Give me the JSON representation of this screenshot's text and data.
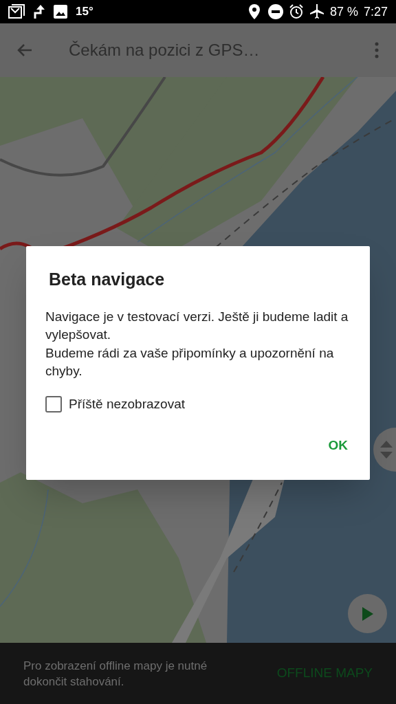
{
  "status_bar": {
    "temperature": "15°",
    "battery": "87 %",
    "time": "7:27"
  },
  "app_bar": {
    "title": "Čekám na pozici z GPS…"
  },
  "dialog": {
    "title": "Beta navigace",
    "paragraphs": [
      "Navigace je v testovací verzi. Ještě ji budeme ladit a vylepšovat.",
      "Budeme rádi za vaše připomínky a upozornění na chyby."
    ],
    "checkbox": {
      "label": "Příště nezobrazovat",
      "checked": false
    },
    "button": "OK"
  },
  "snackbar": {
    "message": "Pro zobrazení offline mapy je nutné dokončit stahování.",
    "action": "OFFLINE MAPY"
  }
}
